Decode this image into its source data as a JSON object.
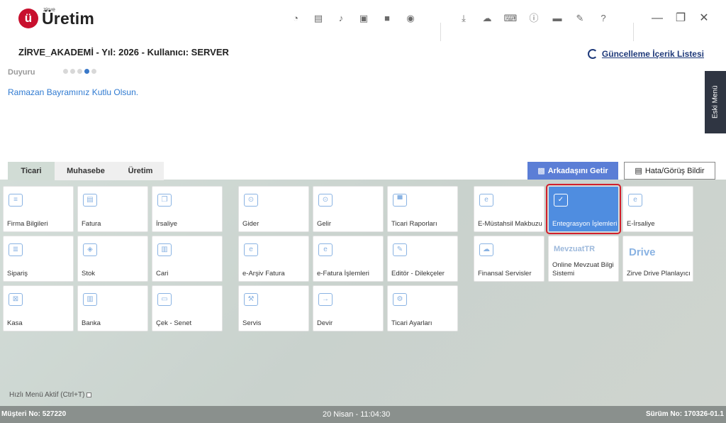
{
  "app": {
    "logo_initial": "ü",
    "logo_small": "zirve",
    "logo_name": "Üretim"
  },
  "header": {
    "info": "ZİRVE_AKADEMİ - Yıl: 2026 - Kullanıcı: SERVER",
    "update_link": "Güncelleme İçerik Listesi"
  },
  "announcement": {
    "label": "Duyuru",
    "text": "Ramazan Bayramınız Kutlu Olsun."
  },
  "side": {
    "old_menu": "Eski Menü"
  },
  "tabs": [
    "Ticari",
    "Muhasebe",
    "Üretim"
  ],
  "buttons": {
    "friend": "Arkadaşını Getir",
    "report": "Hata/Görüş Bildir"
  },
  "tiles": {
    "group1": [
      "Firma Bilgileri",
      "Fatura",
      "İrsaliye",
      "Sipariş",
      "Stok",
      "Cari",
      "Kasa",
      "Banka",
      "Çek - Senet"
    ],
    "group2": [
      "Gider",
      "Gelir",
      "Ticari Raporları",
      "e-Arşiv Fatura",
      "e-Fatura İşlemleri",
      "Editör - Dilekçeler",
      "Servis",
      "Devir",
      "Ticari Ayarları"
    ],
    "group3": [
      "E-Müstahsil Makbuzu",
      "Entegrasyon İşlemleri",
      "E-İrsaliye",
      "Finansal Servisler",
      "Online Mevzuat Bilgi Sistemi",
      "Zirve Drive Planlayıcı"
    ],
    "mevzuat_brand": "MevzuatTR",
    "drive_brand": "Drive"
  },
  "quick_menu": "Hızlı Menü Aktif (Ctrl+T)",
  "status": {
    "customer": "Müşteri No: 527220",
    "datetime": "20 Nisan - 11:04:30",
    "version": "Sürüm No: 170326-01.1"
  },
  "colors": {
    "accent": "#4f8de0",
    "selection_border": "#d21f2c",
    "logo_red": "#c8102e"
  }
}
